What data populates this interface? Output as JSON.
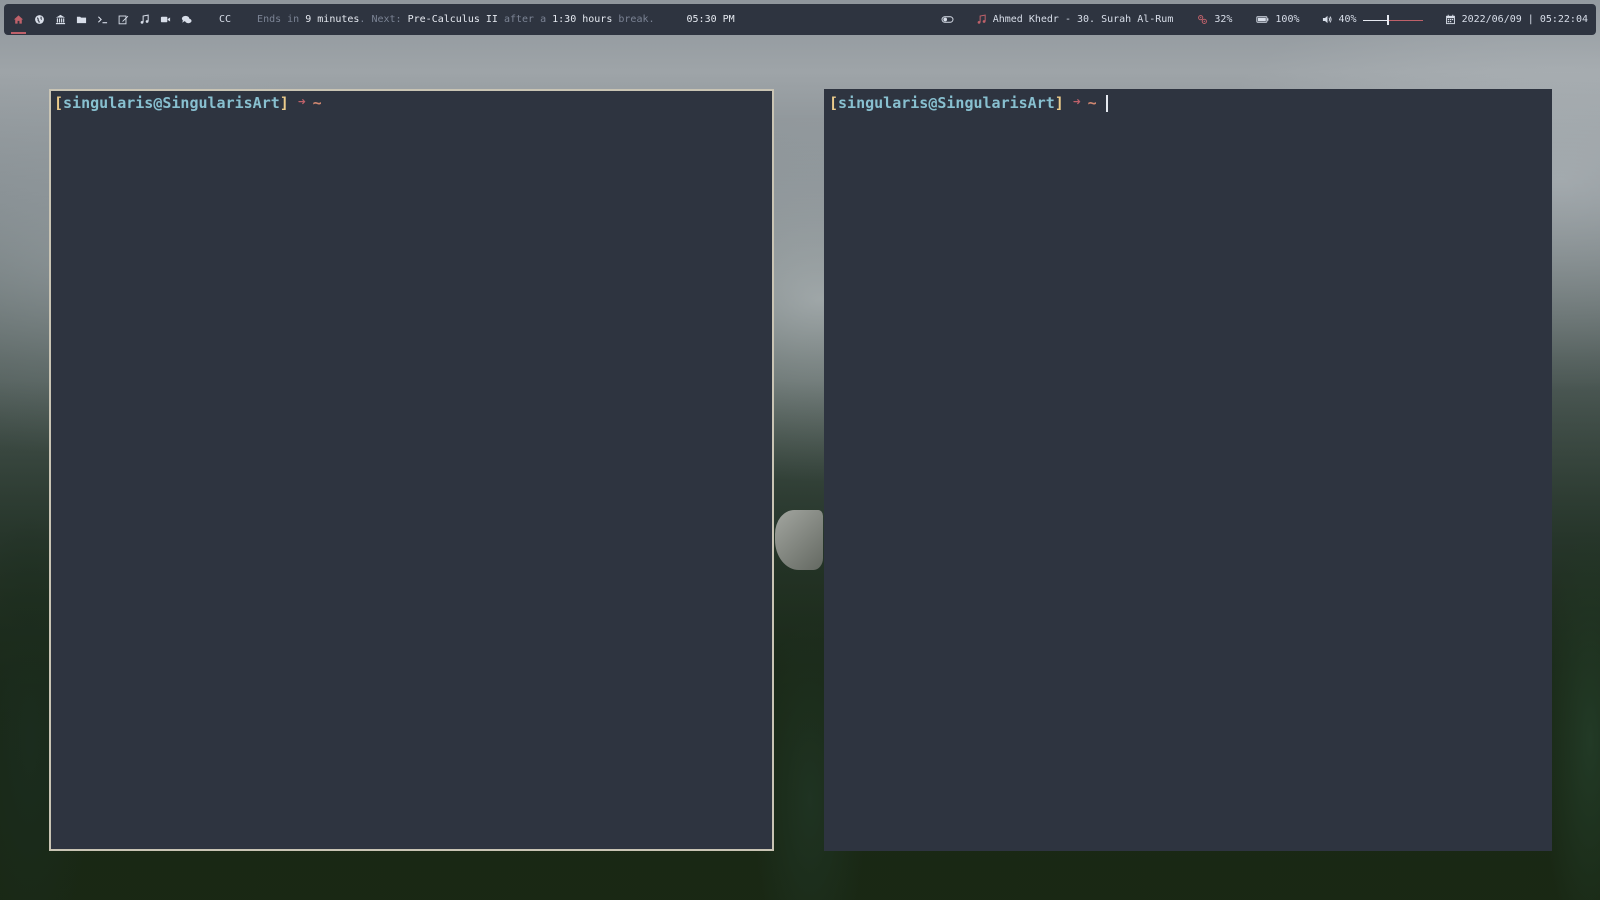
{
  "topbar": {
    "workspaces": [
      {
        "icon": "home-icon",
        "active": true
      },
      {
        "icon": "globe-icon",
        "active": false
      },
      {
        "icon": "bank-icon",
        "active": false
      },
      {
        "icon": "folder-icon",
        "active": false
      },
      {
        "icon": "terminal-icon",
        "active": false
      },
      {
        "icon": "edit-icon",
        "active": false
      },
      {
        "icon": "music-note-icon",
        "active": false
      },
      {
        "icon": "video-camera-icon",
        "active": false
      },
      {
        "icon": "chat-icon",
        "active": false
      }
    ],
    "cc_label": "CC",
    "calendar": {
      "ends_prefix": "Ends in",
      "ends_value": "9 minutes",
      "next_prefix": ". Next:",
      "next_course": "Pre-Calculus II",
      "after_prefix": "after a",
      "break_length": "1:30 hours",
      "break_suffix": "break."
    },
    "clock_time": "05:30 PM",
    "toggle_icon": "toggle-icon",
    "music": {
      "icon": "music-note-icon",
      "track": "Ahmed Khedr - 30. Surah Al-Rum"
    },
    "cpu": {
      "icon": "cpu-icon",
      "value": "32%"
    },
    "battery": {
      "icon": "battery-icon",
      "value": "100%"
    },
    "volume": {
      "icon": "speaker-icon",
      "value": "40%",
      "level": 0.4
    },
    "datetime": {
      "icon": "calendar-icon",
      "value": "2022/06/09 | 05:22:04"
    },
    "colors": {
      "bar_bg": "#2e3440",
      "accent": "#bf616a",
      "text": "#d8dee9"
    }
  },
  "terminals": [
    {
      "open_bracket": "[",
      "user_host": "singularis@SingularisArt",
      "close_bracket": "]",
      "arrow": "➜",
      "dir": "~",
      "focused": true
    },
    {
      "open_bracket": "[",
      "user_host": "singularis@SingularisArt",
      "close_bracket": "]",
      "arrow": "➜",
      "dir": "~",
      "focused": false,
      "cursor_visible": true
    }
  ],
  "colors": {
    "terminal_bg": "#2e3440",
    "bracket": "#ebcb8b",
    "user_host": "#88c0d0",
    "arrow": "#bf616a",
    "dir": "#d08770",
    "focused_border": "#c9c4b4"
  }
}
